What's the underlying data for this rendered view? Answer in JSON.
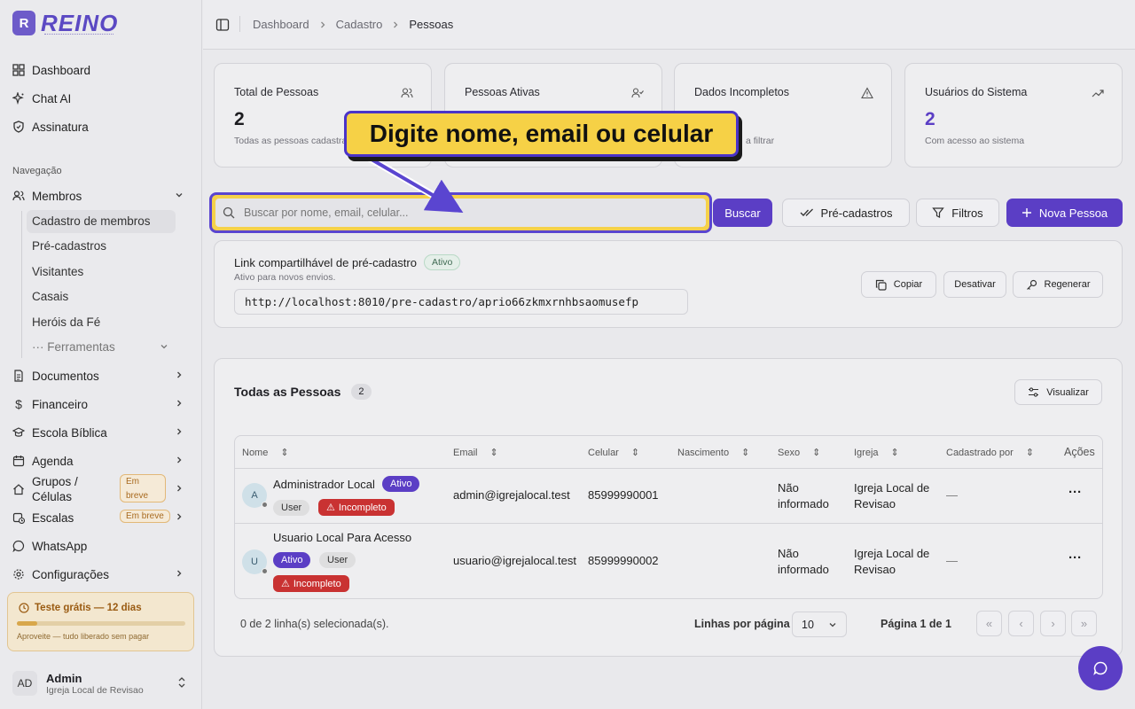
{
  "brand": {
    "name": "REINO",
    "mark": "R"
  },
  "sidebar": {
    "top_items": [
      {
        "label": "Dashboard",
        "icon": "dashboard-icon"
      },
      {
        "label": "Chat AI",
        "icon": "sparkles-icon"
      },
      {
        "label": "Assinatura",
        "icon": "shield-icon"
      }
    ],
    "section_label": "Navegação",
    "membros": {
      "label": "Membros",
      "subitems": [
        "Cadastro de membros",
        "Pré-cadastros",
        "Visitantes",
        "Casais",
        "Heróis da Fé"
      ],
      "ferramentas": "··· Ferramentas"
    },
    "items": [
      {
        "label": "Documentos"
      },
      {
        "label": "Financeiro"
      },
      {
        "label": "Escola Bíblica"
      },
      {
        "label": "Agenda"
      },
      {
        "label": "Grupos / Células",
        "line1": "Grupos /",
        "line2": "Células",
        "badge1": "Em",
        "badge2": "breve"
      },
      {
        "label": "Escalas",
        "badge": "Em breve"
      },
      {
        "label": "WhatsApp"
      },
      {
        "label": "Configurações"
      }
    ],
    "trial": {
      "title": "Teste grátis — 12 dias",
      "subtitle": "Aproveite — tudo liberado sem pagar",
      "progress": 0.12
    },
    "user": {
      "initials": "AD",
      "name": "Admin",
      "church": "Igreja Local de Revisao"
    }
  },
  "header": {
    "breadcrumb": [
      "Dashboard",
      "Cadastro",
      "Pessoas"
    ]
  },
  "stats": [
    {
      "title": "Total de Pessoas",
      "value": "2",
      "subtitle": "Todas as pessoas cadastradas"
    },
    {
      "title": "Pessoas Ativas",
      "value": "",
      "subtitle": ""
    },
    {
      "title": "Dados Incompletos",
      "value": "",
      "subtitle": "a filtrar"
    },
    {
      "title": "Usuários do Sistema",
      "value": "2",
      "subtitle": "Com acesso ao sistema"
    }
  ],
  "callout": "Digite nome, email ou celular",
  "search": {
    "placeholder": "Buscar por nome, email, celular...",
    "buscar": "Buscar",
    "pre_cadastros": "Pré-cadastros",
    "filtros": "Filtros",
    "nova_pessoa": "Nova Pessoa"
  },
  "share_link": {
    "title": "Link compartilhável de pré-cadastro",
    "status": "Ativo",
    "subtitle": "Ativo para novos envios.",
    "url": "http://localhost:8010/pre-cadastro/aprio66zkmxrnhbsaomusefp",
    "copiar": "Copiar",
    "desativar": "Desativar",
    "regenerar": "Regenerar"
  },
  "people": {
    "title": "Todas as Pessoas",
    "count": "2",
    "visualizar": "Visualizar",
    "columns": [
      "Nome",
      "Email",
      "Celular",
      "Nascimento",
      "Sexo",
      "Igreja",
      "Cadastrado por",
      "Ações"
    ],
    "rows": [
      {
        "initial": "A",
        "name": "Administrador Local",
        "status": "Ativo",
        "role": "User",
        "flag": "Incompleto",
        "email": "admin@igrejalocal.test",
        "phone": "85999990001",
        "birth": "",
        "sex1": "Não",
        "sex2": "informado",
        "church1": "Igreja Local de",
        "church2": "Revisao",
        "by": "—"
      },
      {
        "initial": "U",
        "name": "Usuario Local Para Acesso",
        "status": "Ativo",
        "role": "User",
        "flag": "Incompleto",
        "email": "usuario@igrejalocal.test",
        "phone": "85999990002",
        "birth": "",
        "sex1": "Não",
        "sex2": "informado",
        "church1": "Igreja Local de",
        "church2": "Revisao",
        "by": "—"
      }
    ],
    "selected": "0 de 2 linha(s) selecionada(s).",
    "rows_per_page_label": "Linhas por página",
    "rows_per_page": "10",
    "page": "Página 1 de 1"
  },
  "colors": {
    "primary": "#5b3ec5",
    "callout": "#f6d146",
    "danger": "#c93232"
  }
}
